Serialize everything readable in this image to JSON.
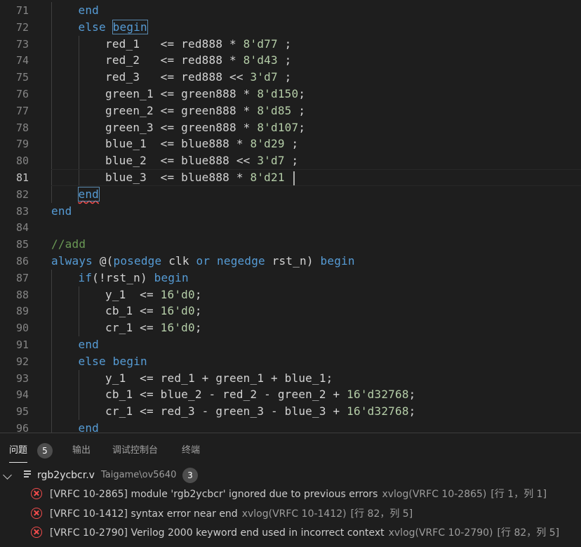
{
  "editor": {
    "lines": [
      {
        "n": "71",
        "indent": 1,
        "tokens": [
          [
            "k",
            "end"
          ]
        ]
      },
      {
        "n": "72",
        "indent": 1,
        "tokens": [
          [
            "k",
            "else "
          ],
          [
            "kb",
            "begin"
          ]
        ]
      },
      {
        "n": "73",
        "indent": 2,
        "tokens": [
          [
            "t",
            "red_1   <= red888 * "
          ],
          [
            "n",
            "8'd77"
          ],
          [
            "t",
            " ;"
          ]
        ]
      },
      {
        "n": "74",
        "indent": 2,
        "tokens": [
          [
            "t",
            "red_2   <= red888 * "
          ],
          [
            "n",
            "8'd43"
          ],
          [
            "t",
            " ;"
          ]
        ]
      },
      {
        "n": "75",
        "indent": 2,
        "tokens": [
          [
            "t",
            "red_3   <= red888 << "
          ],
          [
            "n",
            "3'd7"
          ],
          [
            "t",
            " ;"
          ]
        ]
      },
      {
        "n": "76",
        "indent": 2,
        "tokens": [
          [
            "t",
            "green_1 <= green888 * "
          ],
          [
            "n",
            "8'd150"
          ],
          [
            "t",
            ";"
          ]
        ]
      },
      {
        "n": "77",
        "indent": 2,
        "tokens": [
          [
            "t",
            "green_2 <= green888 * "
          ],
          [
            "n",
            "8'd85"
          ],
          [
            "t",
            " ;"
          ]
        ]
      },
      {
        "n": "78",
        "indent": 2,
        "tokens": [
          [
            "t",
            "green_3 <= green888 * "
          ],
          [
            "n",
            "8'd107"
          ],
          [
            "t",
            ";"
          ]
        ]
      },
      {
        "n": "79",
        "indent": 2,
        "tokens": [
          [
            "t",
            "blue_1  <= blue888 * "
          ],
          [
            "n",
            "8'd29"
          ],
          [
            "t",
            " ;"
          ]
        ]
      },
      {
        "n": "80",
        "indent": 2,
        "tokens": [
          [
            "t",
            "blue_2  <= blue888 << "
          ],
          [
            "n",
            "3'd7"
          ],
          [
            "t",
            " ;"
          ]
        ]
      },
      {
        "n": "81",
        "indent": 2,
        "current": true,
        "tokens": [
          [
            "t",
            "blue_3  <= blue888 * "
          ],
          [
            "n",
            "8'd21"
          ],
          [
            "t",
            " "
          ],
          [
            "cursor",
            ""
          ]
        ]
      },
      {
        "n": "82",
        "indent": 1,
        "tokens": [
          [
            "kbe",
            "end"
          ]
        ]
      },
      {
        "n": "83",
        "indent": 0,
        "tokens": [
          [
            "k",
            "end"
          ]
        ]
      },
      {
        "n": "84",
        "indent": 0,
        "tokens": []
      },
      {
        "n": "85",
        "indent": 0,
        "tokens": [
          [
            "c",
            "//add"
          ]
        ]
      },
      {
        "n": "86",
        "indent": 0,
        "tokens": [
          [
            "k",
            "always "
          ],
          [
            "t",
            "@("
          ],
          [
            "k",
            "posedge "
          ],
          [
            "t",
            "clk "
          ],
          [
            "k",
            "or "
          ],
          [
            "k",
            "negedge "
          ],
          [
            "t",
            "rst_n) "
          ],
          [
            "k",
            "begin"
          ]
        ]
      },
      {
        "n": "87",
        "indent": 1,
        "tokens": [
          [
            "k",
            "if"
          ],
          [
            "t",
            "(!rst_n) "
          ],
          [
            "k",
            "begin"
          ]
        ]
      },
      {
        "n": "88",
        "indent": 2,
        "tokens": [
          [
            "t",
            "y_1  <= "
          ],
          [
            "n",
            "16'd0"
          ],
          [
            "t",
            ";"
          ]
        ]
      },
      {
        "n": "89",
        "indent": 2,
        "tokens": [
          [
            "t",
            "cb_1 <= "
          ],
          [
            "n",
            "16'd0"
          ],
          [
            "t",
            ";"
          ]
        ]
      },
      {
        "n": "90",
        "indent": 2,
        "tokens": [
          [
            "t",
            "cr_1 <= "
          ],
          [
            "n",
            "16'd0"
          ],
          [
            "t",
            ";"
          ]
        ]
      },
      {
        "n": "91",
        "indent": 1,
        "tokens": [
          [
            "k",
            "end"
          ]
        ]
      },
      {
        "n": "92",
        "indent": 1,
        "tokens": [
          [
            "k",
            "else "
          ],
          [
            "k",
            "begin"
          ]
        ]
      },
      {
        "n": "93",
        "indent": 2,
        "tokens": [
          [
            "t",
            "y_1  <= red_1 + green_1 + blue_1;"
          ]
        ]
      },
      {
        "n": "94",
        "indent": 2,
        "tokens": [
          [
            "t",
            "cb_1 <= blue_2 - red_2 - green_2 + "
          ],
          [
            "n",
            "16'd32768"
          ],
          [
            "t",
            ";"
          ]
        ]
      },
      {
        "n": "95",
        "indent": 2,
        "tokens": [
          [
            "t",
            "cr_1 <= red_3 - green_3 - blue_3 + "
          ],
          [
            "n",
            "16'd32768"
          ],
          [
            "t",
            ";"
          ]
        ]
      },
      {
        "n": "96",
        "indent": 1,
        "tokens": [
          [
            "k",
            "end"
          ]
        ]
      }
    ]
  },
  "panel": {
    "tabs": {
      "problems": "问题",
      "problems_count": "5",
      "output": "输出",
      "debug_console": "调试控制台",
      "terminal": "终端"
    },
    "file": {
      "name": "rgb2ycbcr.v",
      "path": "Taigame\\ov5640",
      "count": "3"
    },
    "errors": [
      {
        "msg": "[VRFC 10-2865] module 'rgb2ycbcr' ignored due to previous errors",
        "src": "xvlog(VRFC 10-2865)",
        "pos": "[行 1，列 1]"
      },
      {
        "msg": "[VRFC 10-1412] syntax error near end",
        "src": "xvlog(VRFC 10-1412)",
        "pos": "[行 82，列 5]"
      },
      {
        "msg": "[VRFC 10-2790] Verilog 2000 keyword end used in incorrect context",
        "src": "xvlog(VRFC 10-2790)",
        "pos": "[行 82，列 5]"
      }
    ],
    "error_icon": "error-circle-icon",
    "colors": {
      "error": "#f14c4c",
      "keyword": "#569cd6",
      "number": "#b5cea8",
      "comment": "#6a9955"
    }
  }
}
